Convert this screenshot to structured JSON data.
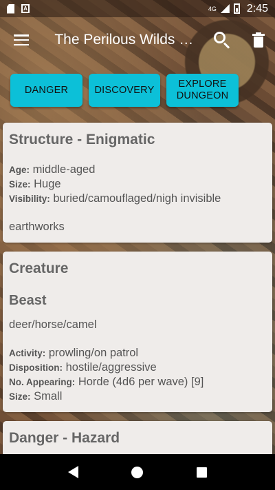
{
  "status_bar": {
    "network": "4G",
    "time": "2:45"
  },
  "app_bar": {
    "title": "The Perilous Wilds Companion",
    "icons": [
      "menu-icon",
      "search-icon",
      "trash-icon"
    ]
  },
  "buttons": [
    {
      "label": "DANGER"
    },
    {
      "label": "DISCOVERY"
    },
    {
      "label": "EXPLORE DUNGEON"
    }
  ],
  "cards": {
    "structure": {
      "title": "Structure - Enigmatic",
      "age_key": "Age:",
      "age_val": "middle-aged",
      "size_key": "Size:",
      "size_val": "Huge",
      "visibility_key": "Visibility:",
      "visibility_val": "buried/camouflaged/nigh invisible",
      "note": "earthworks"
    },
    "creature": {
      "title": "Creature",
      "subtitle": "Beast",
      "kind": "deer/horse/camel",
      "activity_key": "Activity:",
      "activity_val": "prowling/on patrol",
      "disposition_key": "Disposition:",
      "disposition_val": "hostile/aggressive",
      "appearing_key": "No. Appearing:",
      "appearing_val": "Horde (4d6 per wave) [9]",
      "size_key": "Size:",
      "size_val": "Small"
    },
    "danger": {
      "title": "Danger - Hazard"
    }
  },
  "colors": {
    "accent_button": "#0cc0d8",
    "card_bg": "#efecea",
    "nav_bg": "#000000"
  }
}
